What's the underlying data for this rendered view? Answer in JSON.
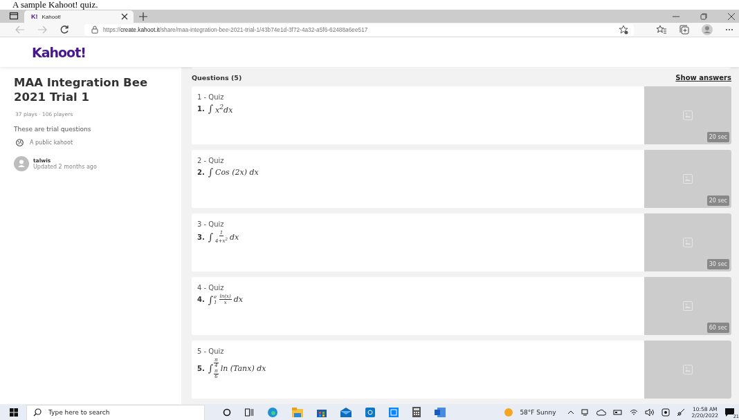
{
  "caption": "A sample Kahoot! quiz.",
  "browser": {
    "tab": {
      "title": "Kahoot!",
      "favicon": "K!",
      "selected": true
    },
    "url": {
      "scheme": "https://",
      "host": "create.kahoot.it",
      "path": "/share/maa-integration-bee-2021-trial-1/43b74e1d-3f72-4a32-a5f6-62488a6ee517"
    }
  },
  "site": {
    "logo": "Kahoot!"
  },
  "kahoot": {
    "title": "MAA Integration Bee 2021 Trial 1",
    "stats": "37 plays · 106 players",
    "description": "These are trial questions",
    "visibility": "A public kahoot",
    "author": "talwis",
    "updated": "Updated 2 months ago"
  },
  "questions_header": {
    "title": "Questions (5)",
    "show_answers": "Show answers"
  },
  "questions": [
    {
      "type": "1 - Quiz",
      "number": "1.",
      "math": [
        {
          "kind": "int",
          "sign": "∫"
        },
        {
          "kind": "text",
          "text": "x$^{2}$dx"
        }
      ],
      "time": "20 sec"
    },
    {
      "type": "2 - Quiz",
      "number": "2.",
      "math": [
        {
          "kind": "int",
          "sign": "∫"
        },
        {
          "kind": "text",
          "text": "Cos (2x) dx"
        }
      ],
      "time": "20 sec"
    },
    {
      "type": "3 - Quiz",
      "number": "3.",
      "math": [
        {
          "kind": "int",
          "sign": "∫"
        },
        {
          "kind": "frac",
          "num": "1",
          "den": "4+x$^{2}$"
        },
        {
          "kind": "text",
          "text": "dx"
        }
      ],
      "time": "30 sec"
    },
    {
      "type": "4 - Quiz",
      "number": "4.",
      "math": [
        {
          "kind": "int",
          "sign": "∫",
          "lower": "1",
          "upper": "e"
        },
        {
          "kind": "frac",
          "num": "ln(x)",
          "den": "x"
        },
        {
          "kind": "text",
          "text": "dx"
        }
      ],
      "time": "60 sec"
    },
    {
      "type": "5 - Quiz",
      "number": "5.",
      "math": [
        {
          "kind": "int",
          "sign": "∫",
          "lower": {
            "num": "π",
            "den": "6"
          },
          "upper": {
            "num": "π",
            "den": "4"
          }
        },
        {
          "kind": "text",
          "text": "ln (Tanx) dx"
        }
      ]
    }
  ],
  "taskbar": {
    "search_placeholder": "Type here to search",
    "weather": "58°F Sunny",
    "time": "10:58 AM",
    "date": "2/20/2022",
    "notifications": "21"
  }
}
